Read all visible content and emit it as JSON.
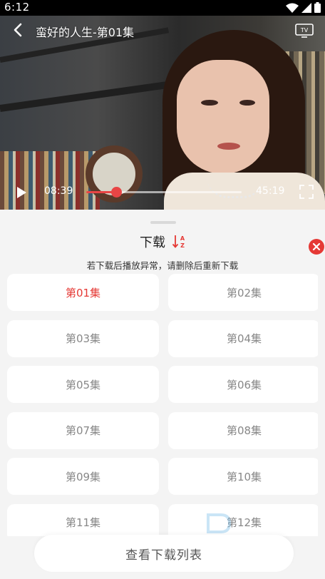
{
  "status_bar": {
    "time": "6:12"
  },
  "video": {
    "title": "蛮好的人生-第01集",
    "current_time": "08:39",
    "total_time": "45:19",
    "progress_fraction": 0.191
  },
  "panel": {
    "title": "下载",
    "notice": "若下载后播放异常，请删除后重新下载",
    "episodes": [
      {
        "label": "第01集",
        "active": true
      },
      {
        "label": "第02集",
        "active": false
      },
      {
        "label": "第03集",
        "active": false
      },
      {
        "label": "第04集",
        "active": false
      },
      {
        "label": "第05集",
        "active": false
      },
      {
        "label": "第06集",
        "active": false
      },
      {
        "label": "第07集",
        "active": false
      },
      {
        "label": "第08集",
        "active": false
      },
      {
        "label": "第09集",
        "active": false
      },
      {
        "label": "第10集",
        "active": false
      },
      {
        "label": "第11集",
        "active": false
      },
      {
        "label": "第12集",
        "active": false
      }
    ],
    "view_list_label": "查看下载列表"
  },
  "colors": {
    "accent": "#e53935",
    "panel_bg": "#f4f4f4"
  },
  "icons": [
    "back-icon",
    "tv-icon",
    "play-icon",
    "fullscreen-icon",
    "sort-az-icon",
    "close-icon",
    "wifi-icon",
    "signal-icon",
    "battery-icon"
  ]
}
